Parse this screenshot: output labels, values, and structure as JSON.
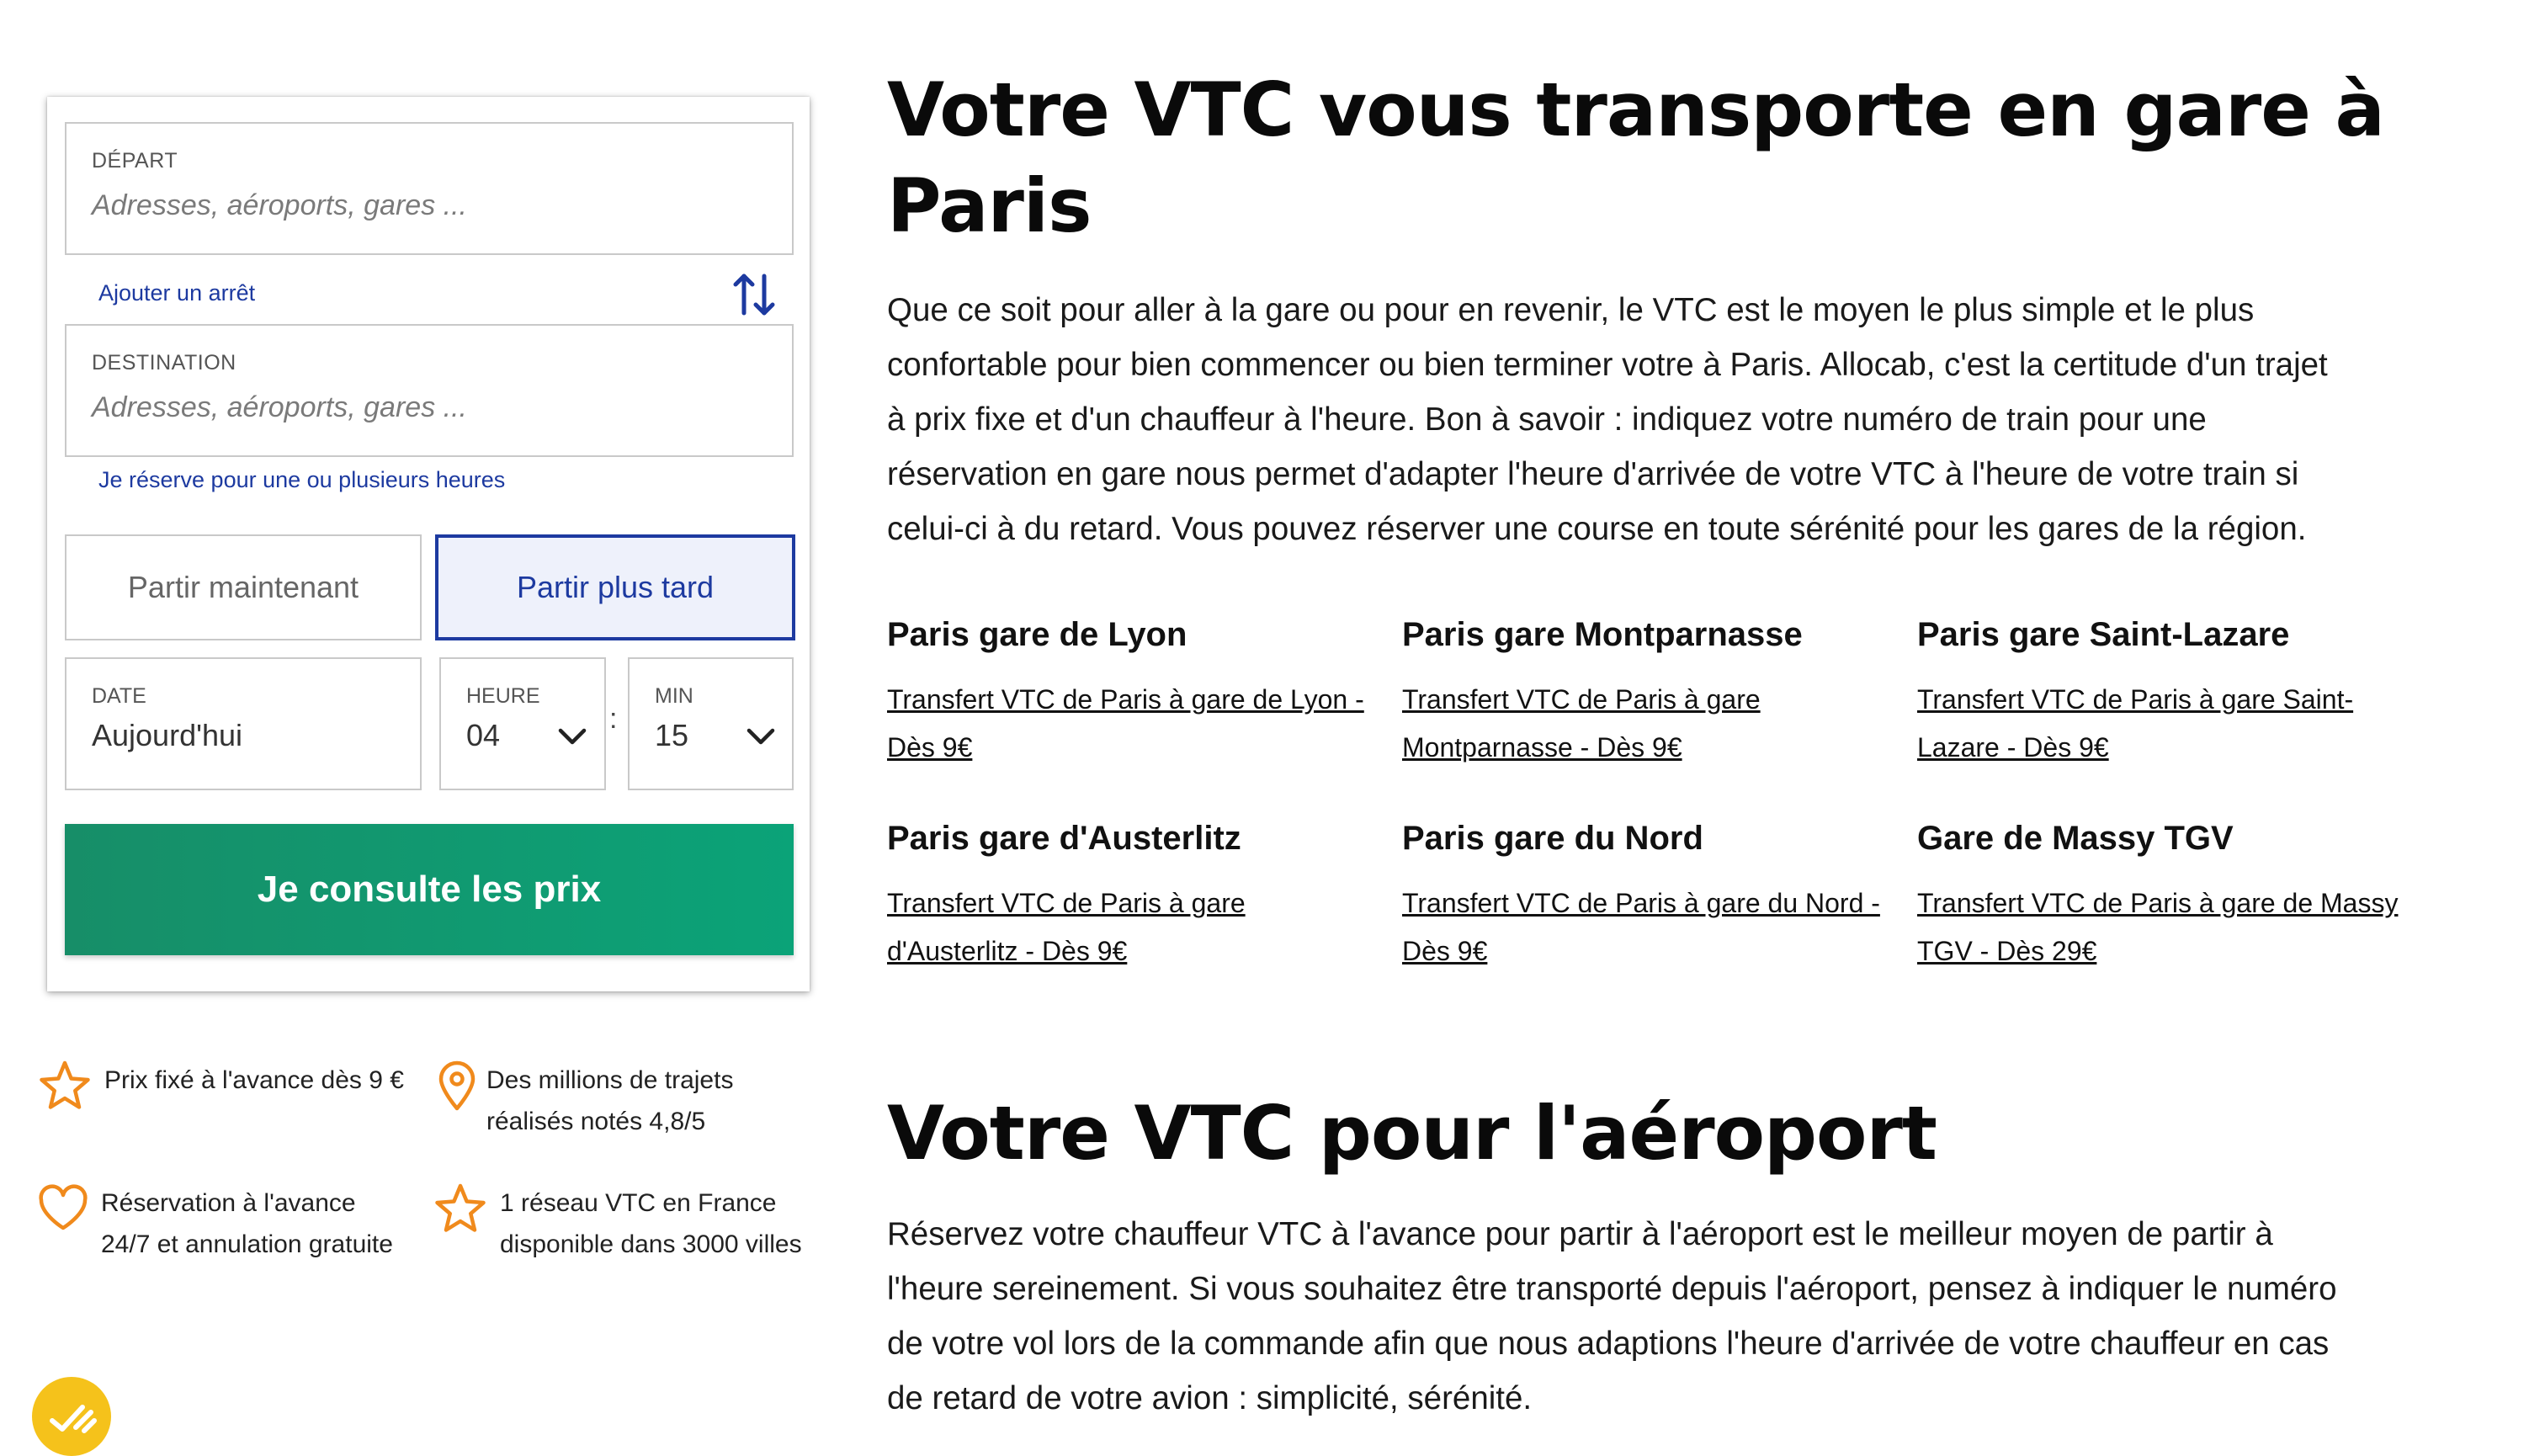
{
  "booking": {
    "departure": {
      "label": "DÉPART",
      "placeholder": "Adresses, aéroports, gares ..."
    },
    "add_stop": "Ajouter un arrêt",
    "destination": {
      "label": "DESTINATION",
      "placeholder": "Adresses, aéroports, gares ..."
    },
    "hourly_link": "Je réserve pour une ou plusieurs heures",
    "leave_now": "Partir maintenant",
    "leave_later": "Partir plus tard",
    "date": {
      "label": "DATE",
      "value": "Aujourd'hui"
    },
    "hour": {
      "label": "HEURE",
      "value": "04"
    },
    "minute": {
      "label": "MIN",
      "value": "15"
    },
    "colon": ":",
    "cta": "Je consulte les prix"
  },
  "features": [
    {
      "icon": "star-icon",
      "lines": [
        "Prix fixé à l'avance dès 9 €"
      ]
    },
    {
      "icon": "map-pin-icon",
      "lines": [
        "Des millions de trajets",
        "réalisés notés 4,8/5"
      ]
    },
    {
      "icon": "heart-icon",
      "lines": [
        "Réservation à l'avance",
        "24/7 et annulation gratuite"
      ]
    },
    {
      "icon": "star-icon",
      "lines": [
        "1 réseau VTC en France",
        "disponible dans 3000 villes"
      ]
    }
  ],
  "section_gares": {
    "title_line1": "Votre VTC vous transporte en gare à",
    "title_line2": "Paris",
    "paragraph_lines": [
      "Que ce soit pour aller à la gare ou pour en revenir, le VTC est le moyen le plus simple et le plus",
      "confortable pour bien commencer ou bien terminer votre à Paris. Allocab, c'est la certitude d'un trajet",
      "à prix fixe et d'un chauffeur à l'heure. Bon à savoir : indiquez votre numéro de train pour une",
      "réservation en gare nous permet d'adapter l'heure d'arrivée de votre VTC à l'heure de votre train si",
      "celui-ci à du retard. Vous pouvez réserver une course en toute sérénité pour les gares de la région."
    ],
    "gares": [
      {
        "name": "Paris gare de Lyon",
        "link_lines": [
          "Transfert VTC de Paris à gare de Lyon -",
          "Dès 9€"
        ]
      },
      {
        "name": "Paris gare Montparnasse",
        "link_lines": [
          "Transfert VTC de Paris à gare",
          "Montparnasse - Dès 9€"
        ]
      },
      {
        "name": "Paris gare Saint-Lazare",
        "link_lines": [
          "Transfert VTC de Paris à gare Saint-",
          "Lazare - Dès 9€"
        ]
      },
      {
        "name": "Paris gare d'Austerlitz",
        "link_lines": [
          "Transfert VTC de Paris à gare",
          "d'Austerlitz - Dès 9€"
        ]
      },
      {
        "name": "Paris gare du Nord",
        "link_lines": [
          "Transfert VTC de Paris à gare du Nord -",
          "Dès 9€"
        ]
      },
      {
        "name": "Gare de Massy TGV",
        "link_lines": [
          "Transfert VTC de Paris à gare de Massy",
          "TGV - Dès 29€"
        ]
      }
    ]
  },
  "section_airport": {
    "title": "Votre VTC pour l'aéroport",
    "paragraph_lines": [
      "Réservez votre chauffeur VTC à l'avance pour partir à l'aéroport est le meilleur moyen de partir à",
      "l'heure sereinement. Si vous souhaitez être transporté depuis l'aéroport, pensez à indiquer le numéro",
      "de votre vol lors de la commande afin que nous adaptions l'heure d'arrivée de votre chauffeur en cas",
      "de retard de votre avion : simplicité, sérénité."
    ]
  },
  "colors": {
    "accent_blue": "#1d3aa0",
    "cta_green": "#0ba378",
    "icon_orange": "#f08a1c",
    "chat_yellow": "#f5c21b"
  }
}
